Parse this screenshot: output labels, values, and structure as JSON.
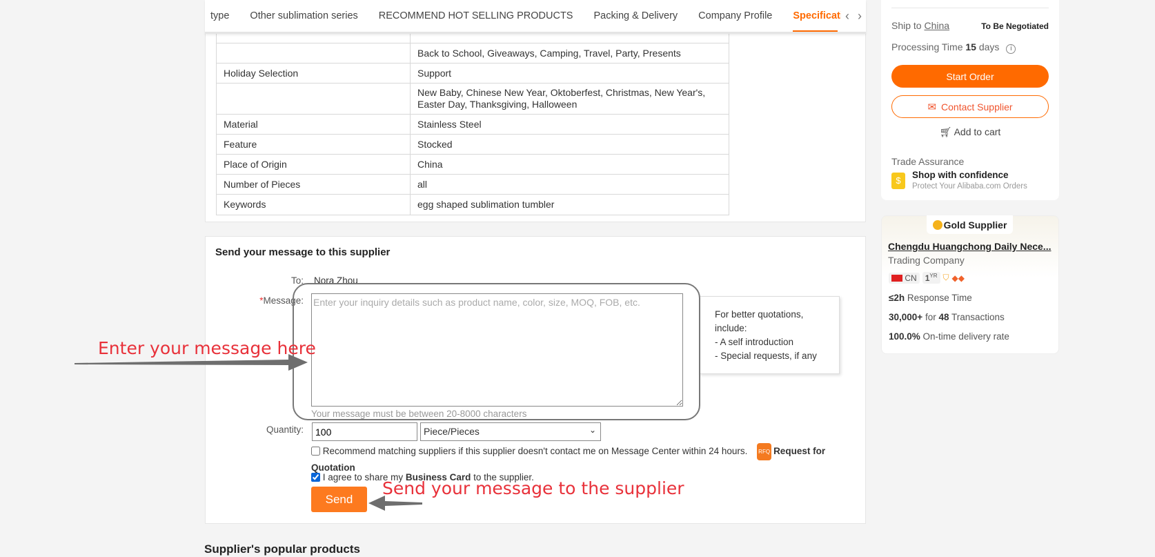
{
  "tabs": {
    "items": [
      "type",
      "Other sublimation series",
      "RECOMMEND HOT SELLING PRODUCTS",
      "Packing & Delivery",
      "Company Profile",
      "Specification"
    ],
    "active": 5
  },
  "spec_table": {
    "rows": [
      [
        "",
        "Back to School, Giveaways, Camping, Travel, Party, Presents"
      ],
      [
        "Holiday Selection",
        "Support"
      ],
      [
        "",
        "New Baby, Chinese New Year, Oktoberfest, Christmas, New Year's, Easter Day, Thanksgiving, Halloween"
      ],
      [
        "Material",
        "Stainless Steel"
      ],
      [
        "Feature",
        "Stocked"
      ],
      [
        "Place of Origin",
        "China"
      ],
      [
        "Number of Pieces",
        "all"
      ],
      [
        "Keywords",
        "egg shaped sublimation tumbler"
      ]
    ]
  },
  "form": {
    "title": "Send your message to this supplier",
    "to_label": "To:",
    "to_value": "Nora Zhou",
    "message_required": "*",
    "message_label": "Message:",
    "message_placeholder": "Enter your inquiry details such as product name, color, size, MOQ, FOB, etc.",
    "message_value": "",
    "hint": "Your message must be between 20-8000 characters",
    "tip": [
      "For better quotations, include:",
      "- A self introduction",
      "- Special requests, if any"
    ],
    "quantity_label": "Quantity:",
    "quantity_value": "100",
    "unit_selected": "Piece/Pieces",
    "recommend_text": "Recommend matching suppliers if this supplier doesn't contact me on Message Center within 24 hours.",
    "rfq_badge": "RFQ",
    "rfq_text": "Request for",
    "rfq_text2": "Quotation",
    "recommend_checked": false,
    "agree_pre": "I agree to share my ",
    "agree_bold": "Business Card",
    "agree_post": " to the supplier.",
    "agree_checked": true,
    "send_label": "Send"
  },
  "annotations": {
    "enter": "Enter your message here",
    "send": "Send your message to the supplier"
  },
  "popular_title": "Supplier's popular products",
  "order_panel": {
    "ship_to": "Ship to",
    "ship_country": "China",
    "negotiated": "To Be Negotiated",
    "processing_pre": "Processing Time ",
    "processing_days": "15",
    "processing_post": " days",
    "start_order": "Start Order",
    "contact_supplier": "Contact Supplier",
    "add_to_cart": "Add to cart",
    "trade_assurance": "Trade Assurance",
    "shop_confidence": "Shop with confidence",
    "protect": "Protect Your Alibaba.com Orders"
  },
  "supplier": {
    "badge": "Gold Supplier",
    "name": "Chengdu Huangchong Daily Nece...",
    "type": "Trading Company",
    "country": "CN",
    "years": "1",
    "years_unit": "YR",
    "response_value": "≤2h",
    "response_label": " Response Time",
    "amount": "30,000+",
    "for": " for ",
    "transactions": "48",
    "transactions_label": " Transactions",
    "ontime": "100.0%",
    "ontime_label": " On-time delivery rate"
  },
  "colors": {
    "accent": "#ff6a00",
    "annotation": "#e8313a"
  }
}
